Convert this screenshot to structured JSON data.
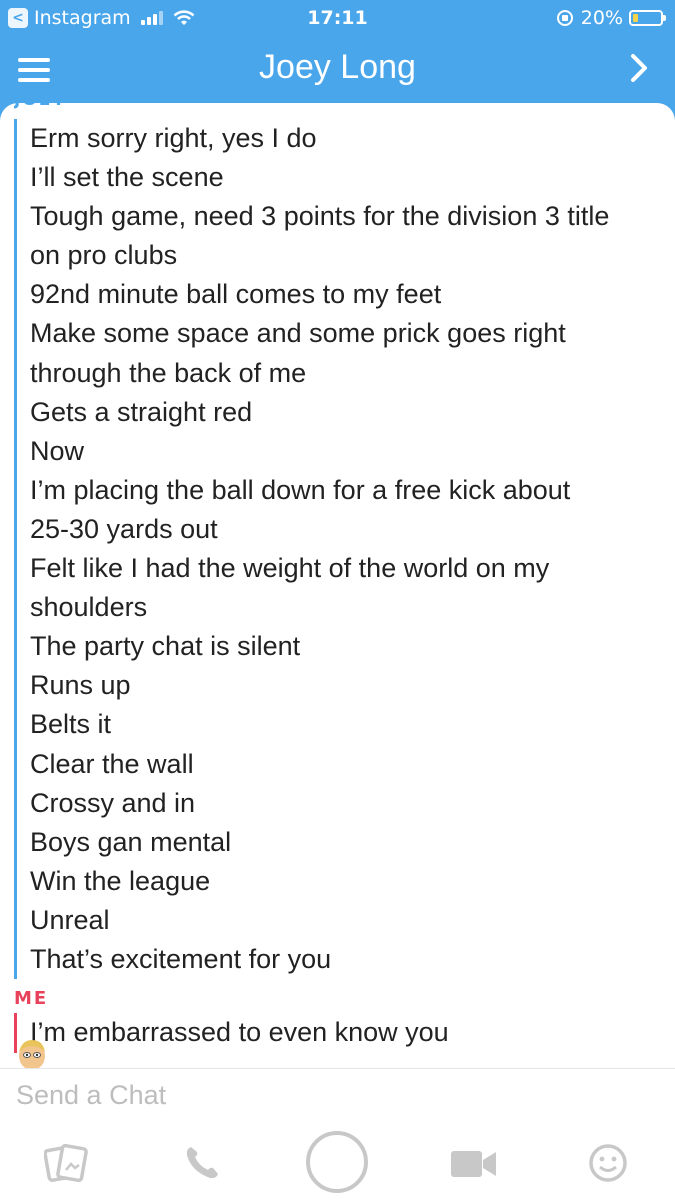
{
  "status_bar": {
    "back_app": "Instagram",
    "time": "17:11",
    "battery": "20%",
    "battery_level": 0.2
  },
  "header": {
    "title": "Joey Long"
  },
  "conversation": {
    "joey_label": "JOEY",
    "joey_messages": [
      "Erm sorry right, yes I do",
      "I’ll set the scene",
      "Tough game, need 3 points for the division 3 title",
      "on pro clubs",
      "92nd minute ball comes to my feet",
      "Make some space and some prick goes right",
      "through the back of me",
      "Gets a straight red",
      "Now",
      "I’m placing the ball down for a free kick about",
      "25-30 yards out",
      "Felt like I had the weight of the world on my",
      "shoulders",
      "The party chat is silent",
      "Runs up",
      "Belts it",
      "Clear the wall",
      "Crossy and in",
      "Boys gan mental",
      "Win the league",
      "Unreal",
      "That’s excitement for you"
    ],
    "me_label": "ME",
    "me_message": "I’m embarrassed to even know you"
  },
  "composer": {
    "placeholder": "Send a Chat"
  },
  "colors": {
    "header_blue": "#4aa6eb",
    "me_red": "#e8415a",
    "icon_gray": "#c8c8c8"
  },
  "icons": [
    "menu-icon",
    "chevron-right-icon",
    "memories-icon",
    "phone-icon",
    "capture-icon",
    "video-icon",
    "emoji-icon"
  ]
}
